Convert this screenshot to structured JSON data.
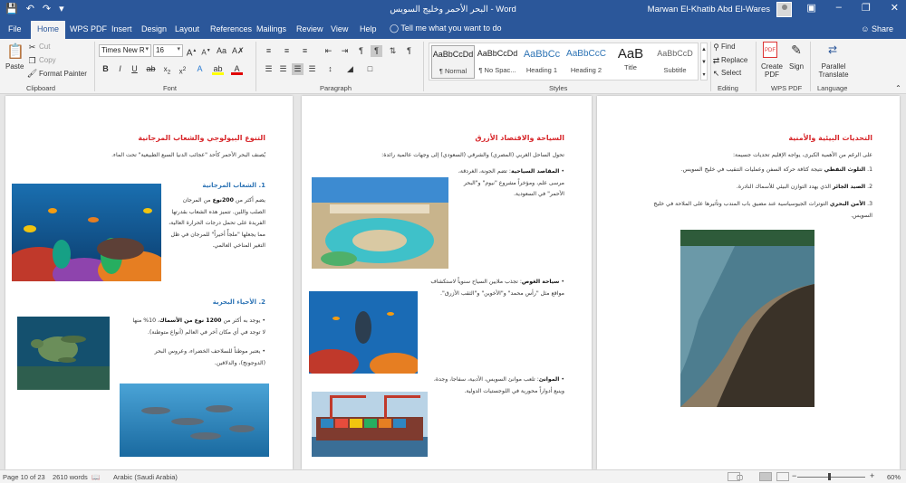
{
  "titlebar": {
    "title": "البحر الأحمر وخليج السويس - Word",
    "user": "Marwan El-Khatib Abd El-Wares",
    "save_icon": "save-icon",
    "undo_icon": "undo-icon",
    "redo_icon": "redo-icon"
  },
  "tabs": {
    "file": "File",
    "home": "Home",
    "wps_pdf": "WPS PDF",
    "insert": "Insert",
    "design": "Design",
    "layout": "Layout",
    "references": "References",
    "mailings": "Mailings",
    "review": "Review",
    "view": "View",
    "help": "Help",
    "tell_me": "Tell me what you want to do",
    "share": "Share"
  },
  "ribbon": {
    "clipboard": {
      "paste": "Paste",
      "cut": "Cut",
      "copy": "Copy",
      "format_painter": "Format Painter",
      "label": "Clipboard"
    },
    "font": {
      "family": "Times New R",
      "size": "16",
      "label": "Font"
    },
    "paragraph": {
      "label": "Paragraph"
    },
    "styles": {
      "label": "Styles",
      "items": [
        {
          "sample": "AaBbCcDd",
          "name": "¶ Normal"
        },
        {
          "sample": "AaBbCcDd",
          "name": "¶ No Spac..."
        },
        {
          "sample": "AaBbCc",
          "name": "Heading 1"
        },
        {
          "sample": "AaBbCcC",
          "name": "Heading 2"
        },
        {
          "sample": "AaB",
          "name": "Title"
        },
        {
          "sample": "AaBbCcD",
          "name": "Subtitle"
        }
      ]
    },
    "editing": {
      "find": "Find",
      "replace": "Replace",
      "select": "Select",
      "label": "Editing"
    },
    "wps": {
      "create_pdf": "Create PDF",
      "sign": "Sign",
      "label": "WPS PDF"
    },
    "language": {
      "translate": "Parallel Translate",
      "label": "Language"
    }
  },
  "pages": {
    "right": {
      "heading": "التحديات البيئية والأمنية",
      "intro": "على الرغم من الأهمية الكبرى، يواجه الإقليم تحديات جسيمة:",
      "items": [
        {
          "num": "1.",
          "bold": "التلوث النفطي",
          "text": " نتيجة كثافة حركة السفن وعمليات التنقيب في خليج السويس."
        },
        {
          "num": "2.",
          "bold": "الصيد الجائر",
          "text": " الذي يهدد التوازن البيئي للأسماك النادرة."
        },
        {
          "num": "3.",
          "bold": "الأمن البحري",
          "text": " التوترات الجيوسياسية عند مضيق باب المندب وتأثيرها على الملاحة في خليج السويس."
        }
      ]
    },
    "middle": {
      "heading": "السياحة والاقتصاد الأزرق",
      "intro": "تحول الساحل الغربي (المصري) والشرقي (السعودي) إلى وجهات عالمية رائدة:",
      "b1_bold": "المقاصد السياحية",
      "b1_text": ": تضم الجونة، الغردقة، مرسى علم، ومؤخراً مشروع \"نيوم\" و\"البحر الأحمر\" في السعودية.",
      "b2_bold": "سياحة الغوص",
      "b2_text": ": تجذب ملايين السياح سنوياً لاستكشاف مواقع مثل \"رأس محمد\" و\"الأخوين\" و\"الثقب الأزرق\".",
      "b3_bold": "الموانئ",
      "b3_text": ": تلعب موانئ السويس، الأدبية، سفاجا، وجدة، وينبع أدواراً محورية في اللوجستيات الدولية."
    },
    "left": {
      "heading": "التنوع البيولوجي والشعاب المرجانية",
      "intro": "يُصنف البحر الأحمر كأحد \"عجائب الدنيا السبع الطبيعية\" تحت الماء.",
      "sub1": "1. الشعاب المرجانية",
      "p1_pre": "يضم أكثر من ",
      "p1_bold": "200",
      "p1_bold2": "نوع",
      "p1_post": " من المرجان الصلب واللين. تتميز هذه الشعاب بقدرتها الفريدة على تحمل درجات الحرارة العالية، مما يجعلها \"ملجأً أخيراً\" للمرجان في ظل التغير المناخي العالمي.",
      "sub2": "2. الأحياء البحرية",
      "b1_pre": "يوجد به أكثر من ",
      "b1_bold": "1200 نوع من الأسماك",
      "b1_post": "، 10% منها لا توجد في أي مكان آخر في العالم (أنواع متوطنة).",
      "b2": "يعتبر موطناً للسلاحف الخضراء، وعروس البحر (الدوجونج)، والدلافين."
    }
  },
  "status": {
    "page": "Page 10 of 23",
    "words": "2610 words",
    "language": "Arabic (Saudi Arabia)",
    "zoom": "60%"
  },
  "colors": {
    "word_blue": "#2b579a",
    "heading_red": "#d7262a",
    "sub_blue": "#2e74b5"
  }
}
